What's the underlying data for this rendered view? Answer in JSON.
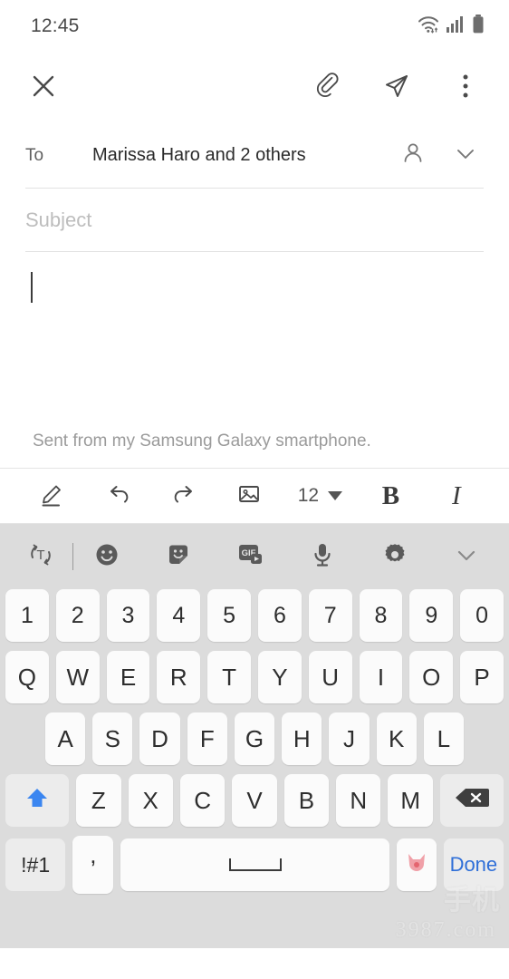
{
  "status_bar": {
    "time": "12:45",
    "icons": [
      "wifi-icon",
      "cellular-signal-icon",
      "battery-icon"
    ]
  },
  "app_bar": {
    "close_label": "close-icon",
    "attach_label": "attachment-icon",
    "send_label": "send-icon",
    "more_label": "more-options-icon"
  },
  "compose": {
    "to_label": "To",
    "to_value": "Marissa Haro and 2 others",
    "contacts_icon": "person-icon",
    "expand_icon": "chevron-down-icon",
    "subject_placeholder": "Subject",
    "body_value": "",
    "signature": "Sent from my Samsung Galaxy smartphone."
  },
  "format_toolbar": {
    "items": [
      {
        "name": "draw-pen",
        "label": "pen-icon"
      },
      {
        "name": "undo",
        "label": "undo-icon"
      },
      {
        "name": "redo",
        "label": "redo-icon"
      },
      {
        "name": "insert-image",
        "label": "image-icon"
      }
    ],
    "font_size": "12",
    "bold_label": "B",
    "italic_label": "I"
  },
  "keyboard": {
    "toolbar": [
      {
        "name": "translate",
        "label": "translate-icon"
      },
      {
        "name": "emoji",
        "label": "emoji-icon"
      },
      {
        "name": "sticker",
        "label": "sticker-icon"
      },
      {
        "name": "gif",
        "label": "GIF"
      },
      {
        "name": "voice-input",
        "label": "microphone-icon"
      },
      {
        "name": "settings",
        "label": "gear-icon"
      },
      {
        "name": "collapse",
        "label": "chevron-down-icon"
      }
    ],
    "row_numbers": [
      "1",
      "2",
      "3",
      "4",
      "5",
      "6",
      "7",
      "8",
      "9",
      "0"
    ],
    "row_top": [
      "Q",
      "W",
      "E",
      "R",
      "T",
      "Y",
      "U",
      "I",
      "O",
      "P"
    ],
    "row_home": [
      "A",
      "S",
      "D",
      "F",
      "G",
      "H",
      "J",
      "K",
      "L"
    ],
    "row_bottom": [
      "Z",
      "X",
      "C",
      "V",
      "B",
      "N",
      "M"
    ],
    "shift_label": "shift-up-icon",
    "backspace_label": "backspace-icon",
    "symbols_label": "!#1",
    "comma_label": ",",
    "space_label": "space-bar",
    "bitmoji_label": "bitmoji-icon",
    "done_label": "Done",
    "shift_active_color": "#3b86f0",
    "done_color": "#2f6fd8",
    "key_color": "#fbfbfb",
    "background_color": "#dcdcdc"
  },
  "watermark": {
    "line1": "手机",
    "line2": "3987.com"
  }
}
